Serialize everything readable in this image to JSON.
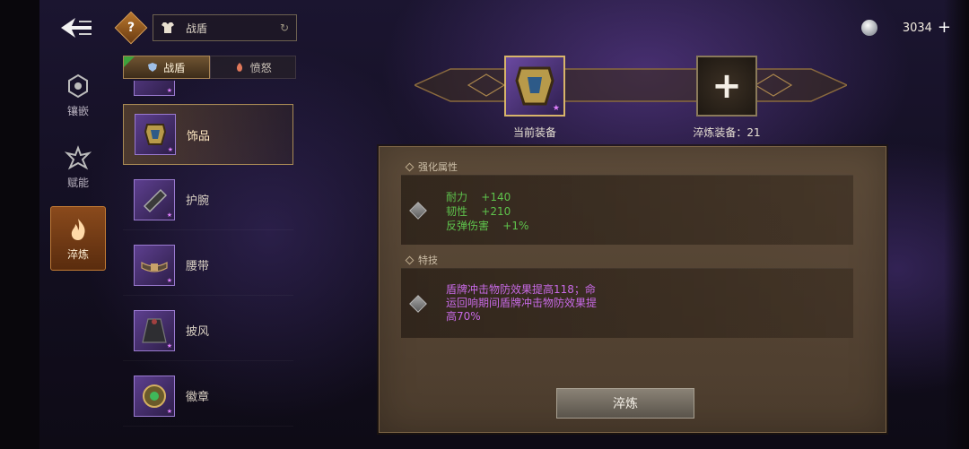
{
  "nav": {
    "items": [
      {
        "label": "镶嵌",
        "icon": "gem-socket-icon",
        "active": false
      },
      {
        "label": "赋能",
        "icon": "empower-icon",
        "active": false
      },
      {
        "label": "淬炼",
        "icon": "flame-icon",
        "active": true
      }
    ]
  },
  "filter": {
    "help": "?",
    "value": "战盾",
    "icon": "armor-icon",
    "refresh_icon": "refresh-icon"
  },
  "tabs": [
    {
      "label": "战盾",
      "active": true
    },
    {
      "label": "愤怒",
      "active": false
    }
  ],
  "equipment_list": [
    {
      "name": "饰品",
      "selected": true
    },
    {
      "name": "护腕",
      "selected": false
    },
    {
      "name": "腰带",
      "selected": false
    },
    {
      "name": "披风",
      "selected": false
    },
    {
      "name": "徽章",
      "selected": false
    }
  ],
  "currency": {
    "value": "3034",
    "add": "+"
  },
  "slots": {
    "current_label": "当前装备",
    "refine_label": "淬炼装备：21",
    "refine_add": "+"
  },
  "panel": {
    "stats_header": "强化属性",
    "stats": [
      {
        "name": "耐力",
        "value": "+140"
      },
      {
        "name": "韧性",
        "value": "+210"
      },
      {
        "name": "反弹伤害",
        "value": "+1%"
      }
    ],
    "skill_header": "特技",
    "skill_text": "盾牌冲击物防效果提高118；命运回响期间盾牌冲击物防效果提高70%",
    "refine_button": "淬炼"
  },
  "colors": {
    "stat_green": "#5ec24c",
    "skill_purple": "#c86ae6",
    "accent_orange": "#c27a34"
  }
}
